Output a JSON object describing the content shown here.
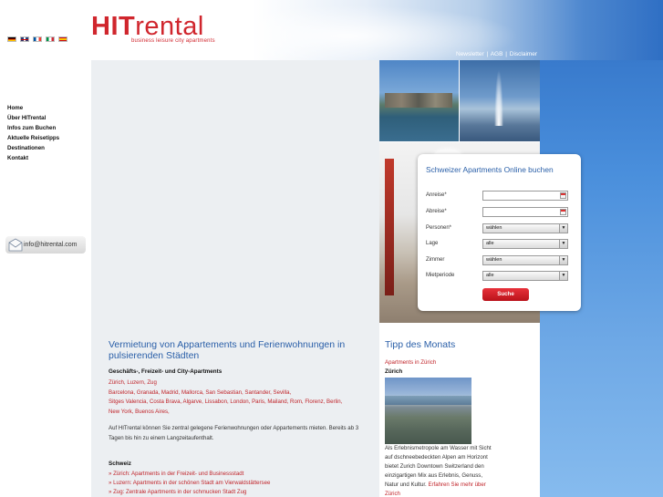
{
  "header": {
    "logo_hit": "HIT",
    "logo_rental": "rental",
    "logo_tagline": "business leisure city apartments",
    "flags": [
      "de-flag-icon",
      "en-flag-icon",
      "fr-flag-icon",
      "it-flag-icon",
      "es-flag-icon"
    ],
    "top_links": [
      "Newsletter",
      "AGB",
      "Disclaimer"
    ],
    "top_sep": "|"
  },
  "nav": {
    "items": [
      "Home",
      "Über HITrental",
      "Infos zum Buchen",
      "Aktuelle Reisetipps",
      "Destinationen",
      "Kontakt"
    ],
    "email": "info@hitrental.com"
  },
  "booking": {
    "title": "Schweizer Apartments Online buchen",
    "fields": [
      {
        "label": "Anreise*",
        "type": "date",
        "value": ""
      },
      {
        "label": "Abreise*",
        "type": "date",
        "value": ""
      },
      {
        "label": "Personen*",
        "type": "select",
        "value": "wählen"
      },
      {
        "label": "Lage",
        "type": "select",
        "value": "alle"
      },
      {
        "label": "Zimmer",
        "type": "select",
        "value": "wählen"
      },
      {
        "label": "Mietperiode",
        "type": "select",
        "value": "alle"
      }
    ],
    "button": "Suche"
  },
  "content": {
    "title": "Vermietung von Appartements und Ferienwohnungen in pulsierenden Städten",
    "subtitle": "Geschäfts-, Freizeit- und City-Apartments",
    "cities": "Zürich, Luzern, Zug\nBarcelona, Granada, Madrid, Mallorca, San Sebastian, Santander, Sevilla,\nSitges Valencia, Costa Brava, Algarve, Lissabon, London, Paris, Mailand, Rom, Florenz, Berlin,\nNew York, Buenos Aires,",
    "paragraph": "Auf HITrental können Sie zentral gelegene Ferienwohnungen oder Appartements mieten. Bereits ab 3 Tagen bis hin zu einem Langzeitaufenthalt.",
    "section": "Schweiz",
    "list": [
      "» Zürich: Apartments in der Freizeit- und Businessstadt",
      "» Luzern: Apartments in der schönen Stadt am Vierwaldstättersee",
      "» Zug: Zentrale Apartments in der schmucken Stadt Zug"
    ]
  },
  "tip": {
    "title": "Tipp des Monats",
    "link": "Apartments in Zürich",
    "city": "Zürich",
    "text": "Als Erlebnismetropole am Wasser mit Sicht auf dschneebedeckten Alpen am Horizont bietet Zurich Downtown Switzerland den einzigartigen Mix aus Erlebnis, Genuss, Natur und Kultur.",
    "more": "Erfahren Sie mehr über Zürich"
  }
}
